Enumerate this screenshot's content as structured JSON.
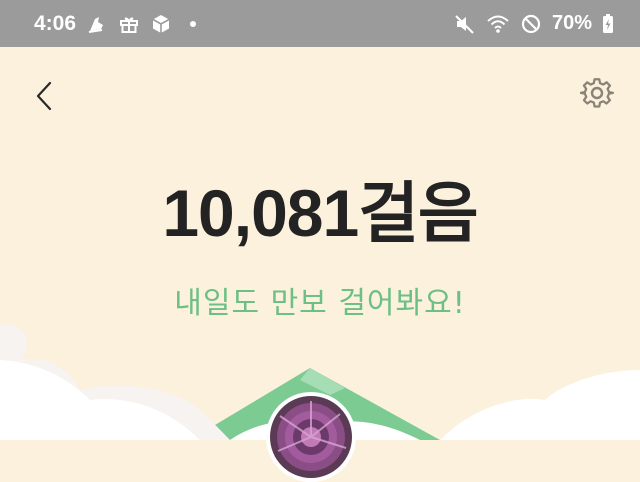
{
  "status_bar": {
    "time": "4:06",
    "battery_percent": "70%",
    "left_icons": [
      "running-shoe-icon",
      "gift-icon",
      "box-icon"
    ],
    "right_icons": [
      "mute-icon",
      "wifi-icon",
      "do-not-disturb-icon",
      "battery-charging-icon"
    ]
  },
  "header": {
    "back_icon": "chevron-left-icon",
    "settings_icon": "gear-icon"
  },
  "main": {
    "steps_text": "10,081걸음",
    "subtitle": "내일도 만보 걸어봐요!"
  },
  "colors": {
    "background": "#fbf1dd",
    "status_bar": "#9b9b9b",
    "accent_green": "#6cbf85",
    "text_dark": "#232323"
  }
}
